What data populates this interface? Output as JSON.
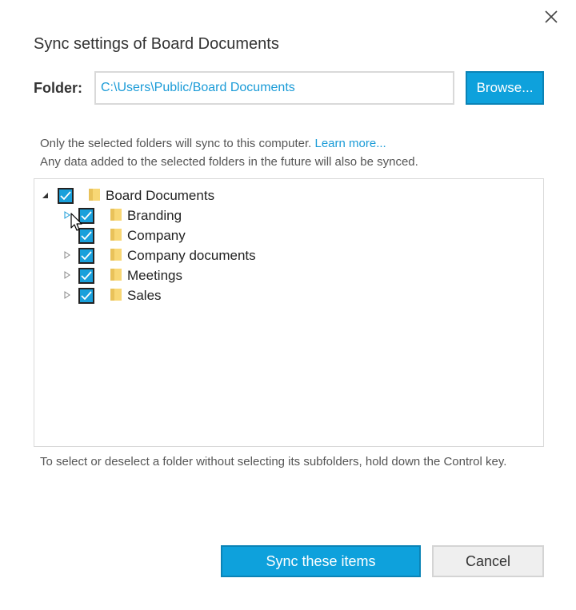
{
  "dialog": {
    "title": "Sync settings of Board Documents",
    "close_icon": "close-icon"
  },
  "folder": {
    "label": "Folder:",
    "value": "C:\\Users\\Public/Board Documents",
    "browse_label": "Browse..."
  },
  "info": {
    "line1": "Only the selected folders will sync to this computer.",
    "learn_more": "Learn more...",
    "line2": "Any data added to the selected folders in the future will also be synced."
  },
  "tree": {
    "root": {
      "label": "Board Documents",
      "expanded": true,
      "checked": true
    },
    "children": [
      {
        "label": "Branding",
        "expandable": true,
        "checked": true,
        "hovered": true
      },
      {
        "label": "Company",
        "expandable": false,
        "checked": true
      },
      {
        "label": "Company documents",
        "expandable": true,
        "checked": true
      },
      {
        "label": "Meetings",
        "expandable": true,
        "checked": true
      },
      {
        "label": "Sales",
        "expandable": true,
        "checked": true
      }
    ]
  },
  "hint": "To select or deselect a folder without selecting its subfolders, hold down the Control key.",
  "buttons": {
    "sync": "Sync these items",
    "cancel": "Cancel"
  },
  "colors": {
    "accent": "#0ea1dc",
    "link": "#1a9bd7",
    "folder": "#f8d775"
  }
}
